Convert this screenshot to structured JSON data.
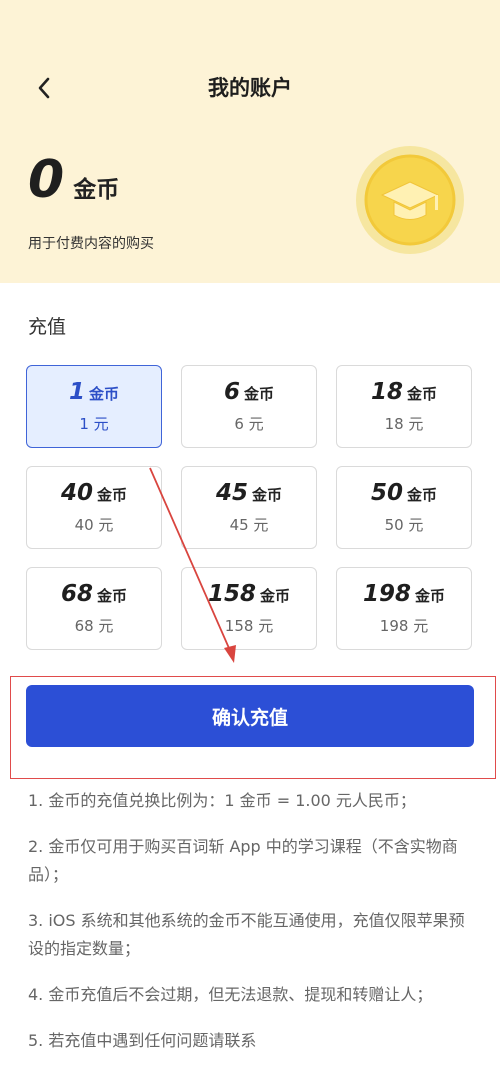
{
  "header": {
    "title": "我的账户",
    "balance_value": "0",
    "balance_unit": "金币",
    "balance_desc": "用于付费内容的购买"
  },
  "recharge": {
    "section_title": "充值",
    "options": [
      {
        "amount": "1",
        "unit": "金币",
        "price": "1 元"
      },
      {
        "amount": "6",
        "unit": "金币",
        "price": "6 元"
      },
      {
        "amount": "18",
        "unit": "金币",
        "price": "18 元"
      },
      {
        "amount": "40",
        "unit": "金币",
        "price": "40 元"
      },
      {
        "amount": "45",
        "unit": "金币",
        "price": "45 元"
      },
      {
        "amount": "50",
        "unit": "金币",
        "price": "50 元"
      },
      {
        "amount": "68",
        "unit": "金币",
        "price": "68 元"
      },
      {
        "amount": "158",
        "unit": "金币",
        "price": "158 元"
      },
      {
        "amount": "198",
        "unit": "金币",
        "price": "198 元"
      }
    ],
    "selected_index": 0,
    "confirm_label": "确认充值"
  },
  "notes": [
    "1. 金币的充值兑换比例为：1 金币 = 1.00 元人民币；",
    "2. 金币仅可用于购买百词斩 App 中的学习课程（不含实物商品）；",
    "3. iOS 系统和其他系统的金币不能互通使用，充值仅限苹果预设的指定数量；",
    "4. 金币充值后不会过期，但无法退款、提现和转赠让人；",
    "5. 若充值中遇到任何问题请联系"
  ],
  "colors": {
    "header_bg": "#fdf3d6",
    "accent": "#2c4fd6",
    "selected_bg": "#e5eeff",
    "annotation_red": "#e04b4b",
    "coin_gold": "#f7d54c"
  },
  "icons": {
    "back": "chevron-left-icon",
    "coin": "graduation-cap-coin-icon"
  }
}
